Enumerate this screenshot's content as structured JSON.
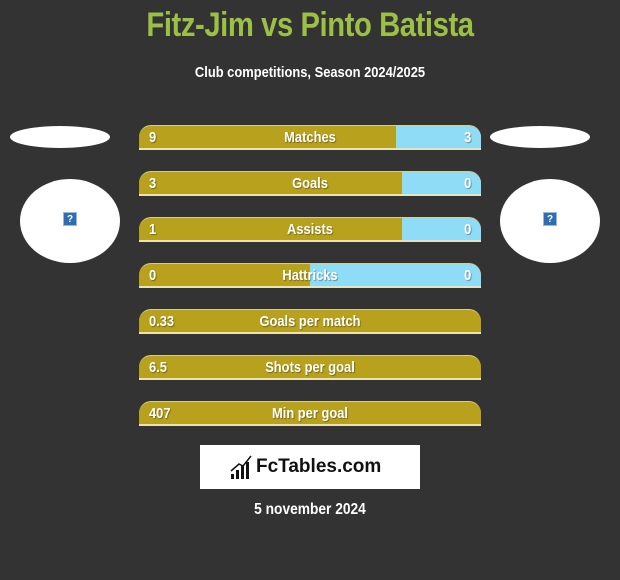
{
  "header": {
    "title": "Fitz-Jim vs Pinto Batista",
    "subtitle": "Club competitions, Season 2024/2025"
  },
  "colors": {
    "left_team": "#b7a11d",
    "right_team": "#8fdcf6",
    "title": "#9cbf46",
    "background": "#333333"
  },
  "teams": {
    "left": {
      "logo_icon": "missing-image-icon"
    },
    "right": {
      "logo_icon": "missing-image-icon"
    }
  },
  "stats": [
    {
      "label": "Matches",
      "left": "9",
      "right": "3",
      "left_share": 0.75
    },
    {
      "label": "Goals",
      "left": "3",
      "right": "0",
      "left_share": 0.77
    },
    {
      "label": "Assists",
      "left": "1",
      "right": "0",
      "left_share": 0.77
    },
    {
      "label": "Hattricks",
      "left": "0",
      "right": "0",
      "left_share": 0.5
    },
    {
      "label": "Goals per match",
      "left": "0.33",
      "right": "",
      "left_share": 1.0
    },
    {
      "label": "Shots per goal",
      "left": "6.5",
      "right": "",
      "left_share": 1.0
    },
    {
      "label": "Min per goal",
      "left": "407",
      "right": "",
      "left_share": 1.0
    }
  ],
  "footer": {
    "brand": "FcTables.com",
    "date": "5 november 2024"
  }
}
